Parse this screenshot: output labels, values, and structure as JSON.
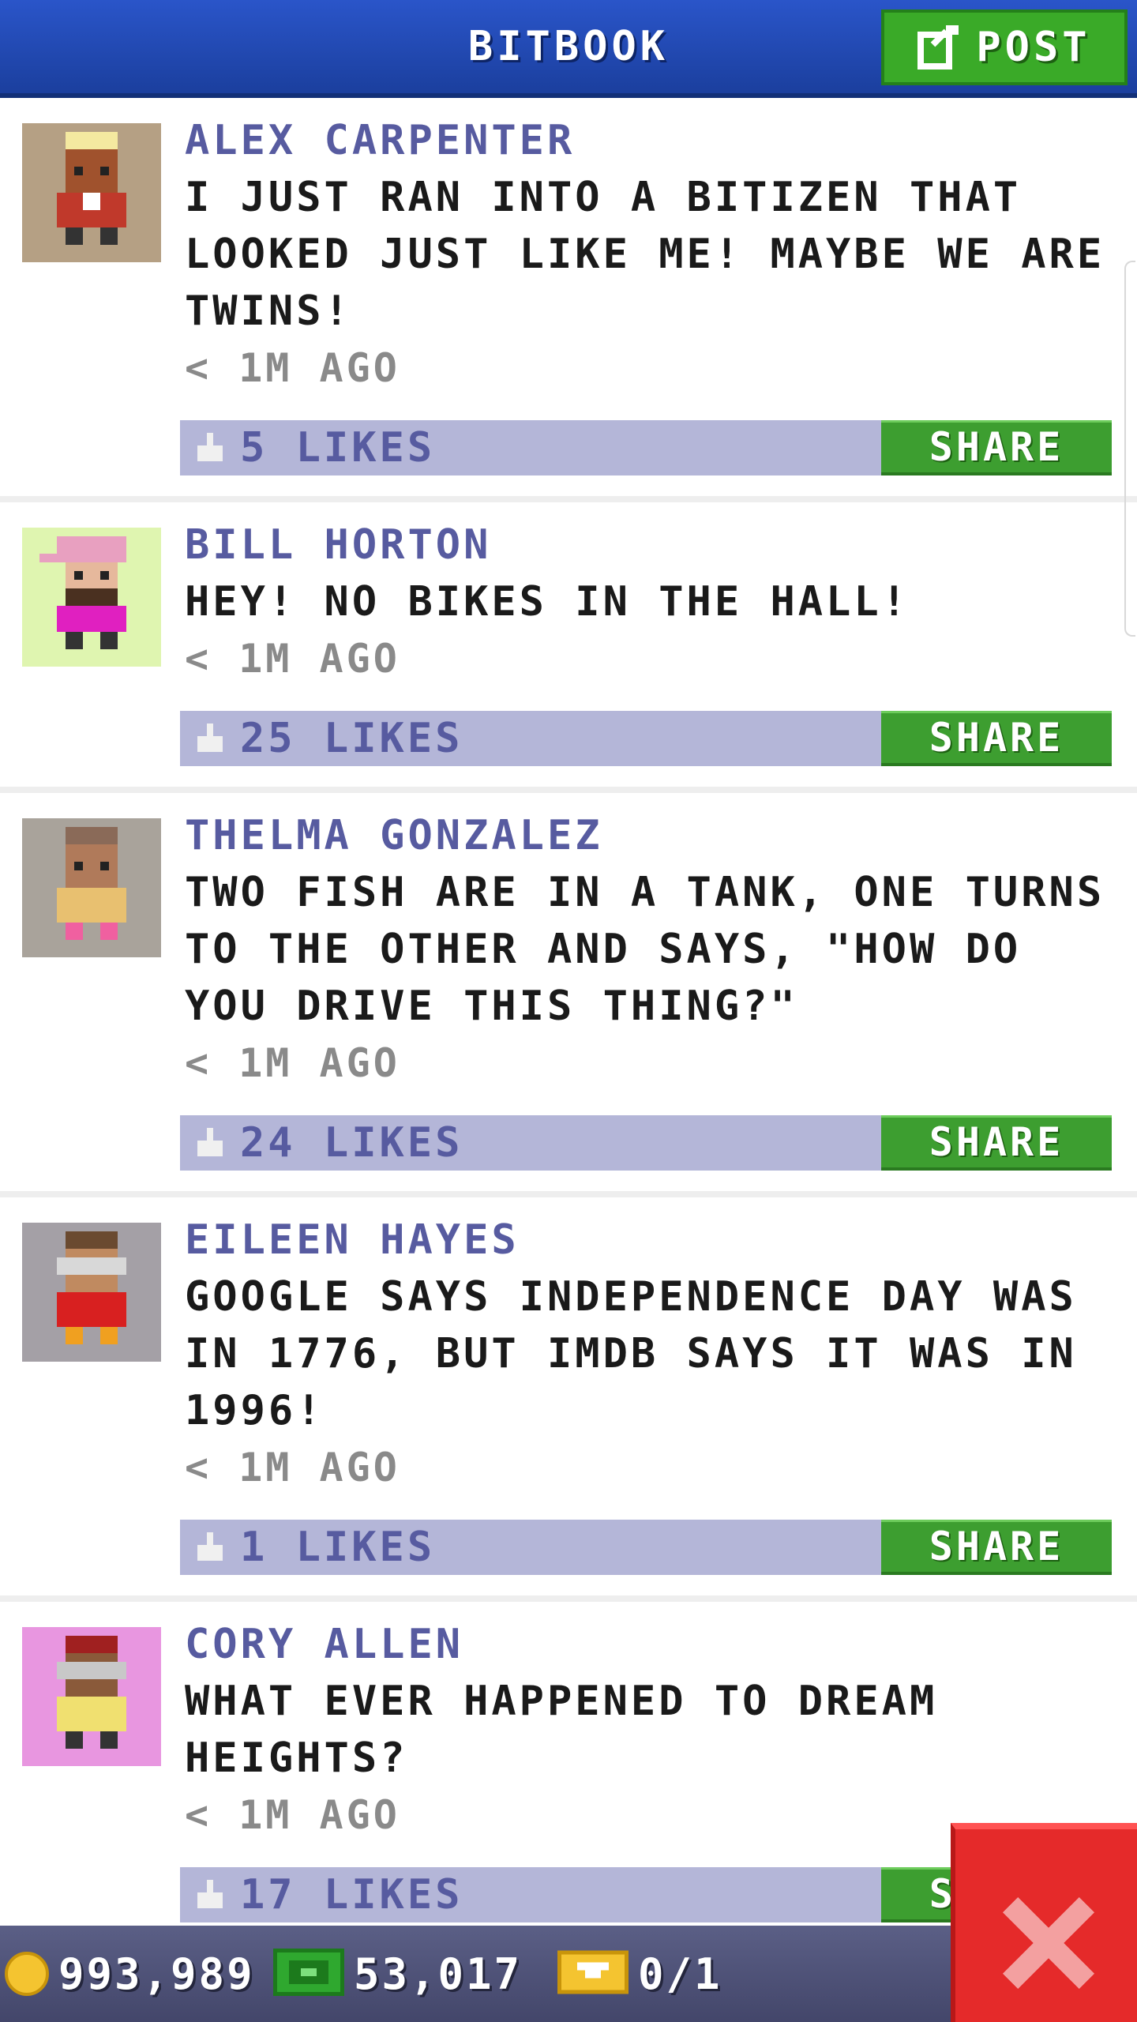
{
  "header": {
    "title": "BITBOOK",
    "post_label": "POST"
  },
  "posts": [
    {
      "author": "ALEX CARPENTER",
      "text": "I JUST RAN INTO A BITIZEN THAT LOOKED JUST LIKE ME! MAYBE WE ARE TWINS!",
      "time": "< 1M AGO",
      "likes": "5 LIKES",
      "share": "SHARE"
    },
    {
      "author": "BILL HORTON",
      "text": "HEY! NO BIKES IN THE HALL!",
      "time": "< 1M AGO",
      "likes": "25 LIKES",
      "share": "SHARE"
    },
    {
      "author": "THELMA GONZALEZ",
      "text": "TWO FISH ARE IN A TANK, ONE TURNS TO THE OTHER AND SAYS, \"HOW DO YOU DRIVE THIS THING?\"",
      "time": "< 1M AGO",
      "likes": "24 LIKES",
      "share": "SHARE"
    },
    {
      "author": "EILEEN HAYES",
      "text": "GOOGLE SAYS INDEPENDENCE DAY WAS IN 1776, BUT IMDB SAYS IT WAS IN 1996!",
      "time": "< 1M AGO",
      "likes": "1 LIKES",
      "share": "SHARE"
    },
    {
      "author": "CORY ALLEN",
      "text": "WHAT EVER HAPPENED TO DREAM HEIGHTS?",
      "time": "< 1M AGO",
      "likes": "17 LIKES",
      "share": "SHARE"
    }
  ],
  "bottom_bar": {
    "coins": "993,989",
    "bux": "53,017",
    "tickets": "0/1"
  },
  "colors": {
    "header_blue": "#2a55c9",
    "post_green": "#3aaa28",
    "author_purple": "#575ba0",
    "like_bar": "#b4b6d8",
    "share_green": "#3d9e30",
    "close_red": "#e52a2a"
  },
  "icons": {
    "post": "edit-icon",
    "like": "thumbs-up-icon",
    "coin": "coin-icon",
    "bux": "bux-icon",
    "ticket": "ticket-icon",
    "close": "close-icon"
  }
}
